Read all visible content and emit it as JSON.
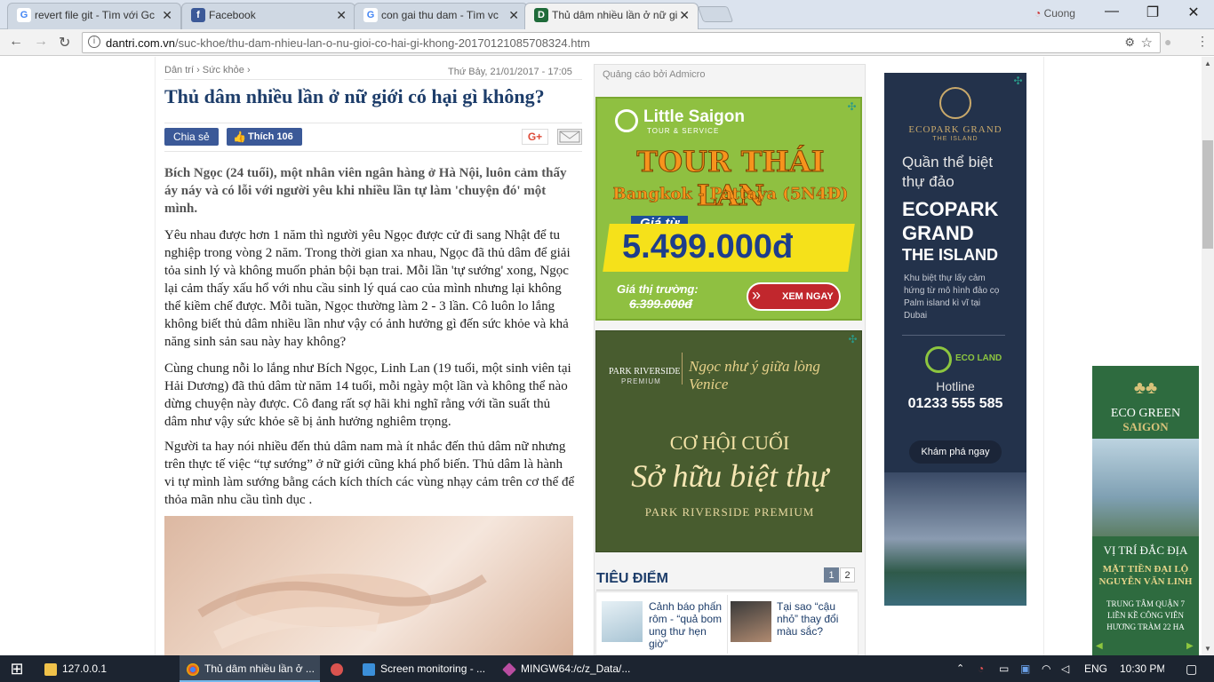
{
  "browser": {
    "tabs": [
      {
        "label": "revert file git - Tìm với Gc",
        "icon": "google-icon"
      },
      {
        "label": "Facebook",
        "icon": "facebook-icon"
      },
      {
        "label": "con gai thu dam - Tìm vc",
        "icon": "google-icon"
      },
      {
        "label": "Thủ dâm nhiều lần ở nữ gi",
        "icon": "dantri-icon"
      }
    ],
    "profile_name": "Cuong",
    "url_domain": "dantri.com.vn",
    "url_path": "/suc-khoe/thu-dam-nhieu-lan-o-nu-gioi-co-hai-gi-khong-20170121085708324.htm"
  },
  "article": {
    "breadcrumb": [
      "Dân trí",
      "Sức khỏe"
    ],
    "datetime": "Thứ Bảy, 21/01/2017 - 17:05",
    "title": "Thủ dâm nhiều lần ở nữ giới có hại gì không?",
    "share_label": "Chia sẻ",
    "like_label": "Thích 106",
    "gplus_label": "G+",
    "lead": "Bích Ngọc (24 tuổi), một nhân viên ngân hàng ở Hà Nội, luôn cảm thấy áy náy và có lỗi với người yêu khi nhiều lần tự làm 'chuyện đó' một mình.",
    "paragraphs": [
      "Yêu nhau được hơn 1 năm thì người yêu Ngọc được cử đi sang Nhật để tu nghiệp trong vòng 2 năm. Trong thời gian xa nhau, Ngọc đã thủ dâm để giải tỏa sinh lý và không muốn phản bội bạn trai. Mỗi lần 'tự sướng' xong, Ngọc lại cảm thấy xấu hổ với nhu cầu sinh lý quá cao của mình nhưng lại không thể kiềm chế được. Mỗi tuần, Ngọc thường làm 2 - 3 lần. Cô luôn lo lắng không biết thủ dâm nhiều lần như vậy có ảnh hưởng gì đến sức khỏe và khả năng sinh sản sau này hay không?",
      "Cùng chung nỗi lo lắng như Bích Ngọc, Linh Lan (19 tuổi, một sinh viên tại Hải Dương) đã thủ dâm từ năm 14 tuổi, mỗi ngày một lần và không thể nào dừng chuyện này được. Cô đang rất sợ hãi khi nghĩ rằng với tần suất thủ dâm như vậy sức khỏe sẽ bị ảnh hưởng nghiêm trọng.",
      "Người ta hay nói nhiều đến thủ dâm nam mà ít nhắc đến thủ dâm nữ nhưng trên thực tế việc “tự sướng” ở nữ giới cũng khá phổ biến. Thủ dâm là hành vi tự mình làm sướng bằng cách kích thích các vùng nhạy cảm trên cơ thể để thỏa mãn nhu cầu tình dục ."
    ]
  },
  "sidebar": {
    "ad_label": "Quảng cáo bởi Admicro",
    "ad1": {
      "brand": "Little Saigon",
      "brand_sub": "TOUR & SERVICE",
      "headline": "TOUR THÁI LAN",
      "route": "Bangkok - Pattaya (5N4Đ)",
      "price_label": "Giá từ",
      "price": "5.499.000đ",
      "market_label": "Giá thị trường:",
      "market_price": "6.399.000đ",
      "cta": "XEM NGAY"
    },
    "ad2": {
      "brand": "PARK RIVERSIDE",
      "brand_sub": "PREMIUM",
      "tagline": "Ngọc như ý giữa lòng Venice",
      "line1": "CƠ HỘI CUỐI",
      "line2": "Sở hữu biệt thự",
      "line3": "PARK RIVERSIDE PREMIUM"
    },
    "tieudiem": {
      "title": "TIÊU ĐIỂM",
      "pages": [
        "1",
        "2"
      ],
      "items": [
        {
          "text": "Cảnh báo phấn rôm - “quả bom ung thư hẹn giờ”"
        },
        {
          "text": "Tại sao “cậu nhỏ” thay đổi màu sắc?"
        }
      ]
    }
  },
  "right_ads": {
    "ecopark": {
      "brand": "ECOPARK GRAND",
      "brand_sub": "THE ISLAND",
      "intro": "Quần thể biệt thự đảo",
      "title1": "ECOPARK",
      "title2": "GRAND",
      "title3": "THE ISLAND",
      "desc": "Khu biệt thự lấy cảm hứng từ mô hình đảo cọ Palm island kì vĩ tại Dubai",
      "logo": "ECO LAND",
      "hotline_label": "Hotline",
      "hotline": "01233 555 585",
      "cta": "Khám phá ngay"
    },
    "ecogreen": {
      "brand1": "ECO GREEN",
      "brand2": "SAIGON",
      "line1": "VỊ TRÍ ĐẮC ĐỊA",
      "line2": "MẶT TIỀN ĐẠI LỘ NGUYỄN VĂN LINH",
      "line3": "TRUNG TÂM QUẬN 7 LIỀN KỀ CÔNG VIÊN HƯƠNG TRÀM 22 HA"
    }
  },
  "taskbar": {
    "items": [
      {
        "label": "127.0.0.1",
        "icon": "folder-icon"
      },
      {
        "label": "Thủ dâm nhiều lần ở ...",
        "icon": "chrome-icon"
      },
      {
        "label": "",
        "icon": "app-icon"
      },
      {
        "label": "Screen monitoring - ...",
        "icon": "monitor-icon"
      },
      {
        "label": "MINGW64:/c/z_Data/...",
        "icon": "git-icon"
      }
    ],
    "lang": "ENG",
    "time": "10:30 PM"
  },
  "colors": {
    "title": "#1d3d6a",
    "facebook": "#3b5998",
    "ad_green": "#8fc041",
    "ad_orange": "#f7941d",
    "taskbar": "#1c2430"
  }
}
